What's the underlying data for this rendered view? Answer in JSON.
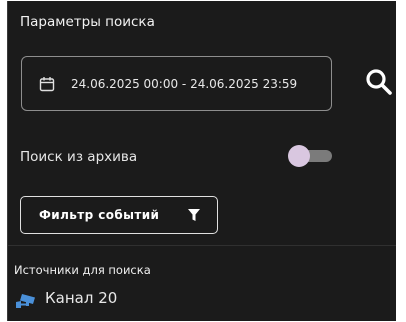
{
  "panel": {
    "title": "Параметры поиска"
  },
  "date_range": {
    "value": "24.06.2025 00:00 - 24.06.2025 23:59",
    "icon": "calendar-icon"
  },
  "search_button": {
    "icon": "search-icon"
  },
  "archive_search": {
    "label": "Поиск из архива",
    "enabled": false
  },
  "filter_button": {
    "label": "Фильтр событий",
    "icon": "funnel-icon"
  },
  "sources": {
    "title": "Источники для поиска",
    "items": [
      {
        "label": "Канал 20",
        "icon": "camera-icon"
      }
    ]
  },
  "colors": {
    "background": "#1b1b1b",
    "text": "#e8e8e8",
    "toggle_knob": "#d9c7e0",
    "camera_icon": "#4a90d9"
  }
}
